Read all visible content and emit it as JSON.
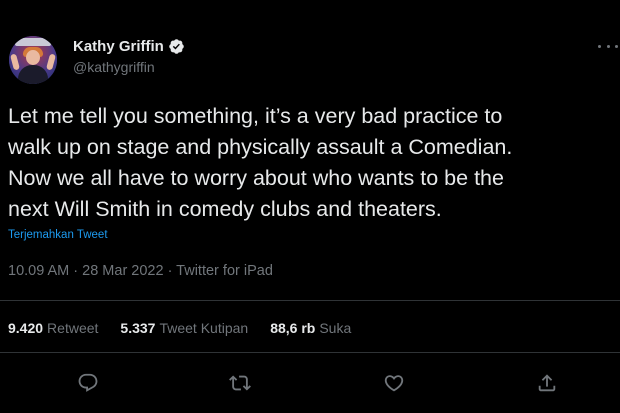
{
  "author": {
    "display_name": "Kathy Griffin",
    "handle": "@kathygriffin",
    "verified": true,
    "avatar_icon": "avatar-photo"
  },
  "tweet": {
    "text_lines": [
      "Let me tell you something, it’s a very bad practice to",
      "walk up on stage and physically assault a Comedian.",
      "Now we all have to worry about who wants to be the",
      "next Will Smith in comedy clubs and theaters."
    ],
    "translate_label": "Terjemahkan Tweet",
    "timestamp": "10.09 AM · 28 Mar 2022 · Twitter for iPad"
  },
  "stats": {
    "retweets": {
      "count": "9.420",
      "label": "Retweet"
    },
    "quotes": {
      "count": "5.337",
      "label": "Tweet Kutipan"
    },
    "likes": {
      "count": "88,6 rb",
      "label": "Suka"
    }
  },
  "actions": {
    "reply_icon": "reply-icon",
    "retweet_icon": "retweet-icon",
    "like_icon": "heart-icon",
    "share_icon": "share-icon"
  },
  "colors": {
    "background": "#000000",
    "text_primary": "#e7e9ea",
    "text_secondary": "#71767b",
    "link": "#1d9bf0",
    "verified_badge": "#e7e9ea",
    "divider": "#2f3336"
  }
}
